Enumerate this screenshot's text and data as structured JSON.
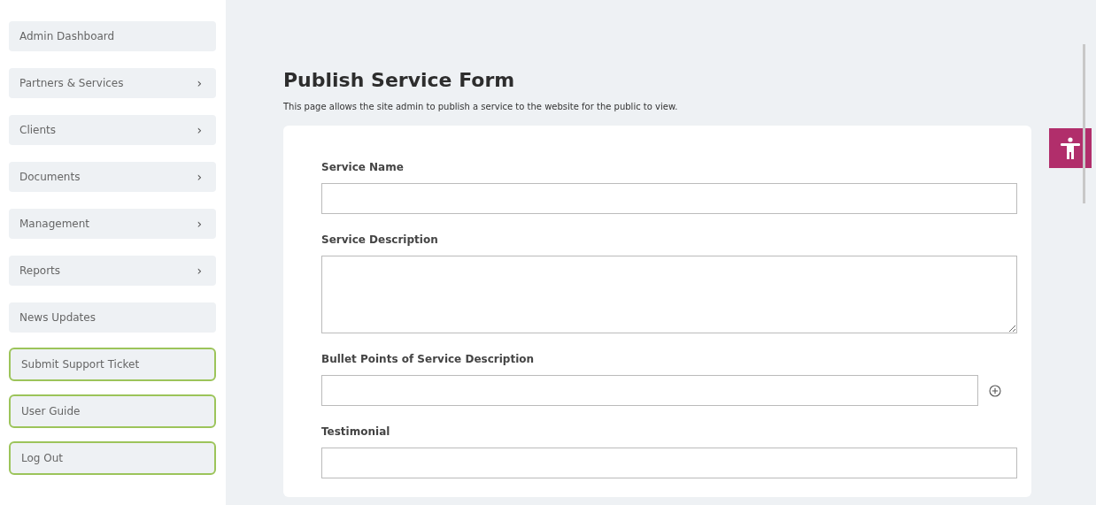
{
  "sidebar": {
    "items": [
      {
        "label": "Admin Dashboard",
        "kind": "link"
      },
      {
        "label": "Partners & Services",
        "kind": "submenu",
        "chevron": "›"
      },
      {
        "label": "Clients",
        "kind": "submenu",
        "chevron": "›"
      },
      {
        "label": "Documents",
        "kind": "submenu",
        "chevron": "›"
      },
      {
        "label": "Management",
        "kind": "submenu",
        "chevron": "›"
      },
      {
        "label": "Reports",
        "kind": "submenu",
        "chevron": "›"
      },
      {
        "label": "News Updates",
        "kind": "link"
      },
      {
        "label": "Submit Support Ticket",
        "kind": "action"
      },
      {
        "label": "User Guide",
        "kind": "action"
      },
      {
        "label": "Log Out",
        "kind": "action"
      }
    ]
  },
  "page": {
    "title": "Publish Service Form",
    "description": "This page allows the site admin to publish a service to the website for the public to view."
  },
  "form": {
    "fields": [
      {
        "label": "Service Name",
        "kind": "text"
      },
      {
        "label": "Service Description",
        "kind": "textarea"
      },
      {
        "label": "Bullet Points of Service Description",
        "kind": "addable"
      },
      {
        "label": "Testimonial",
        "kind": "text"
      }
    ]
  }
}
